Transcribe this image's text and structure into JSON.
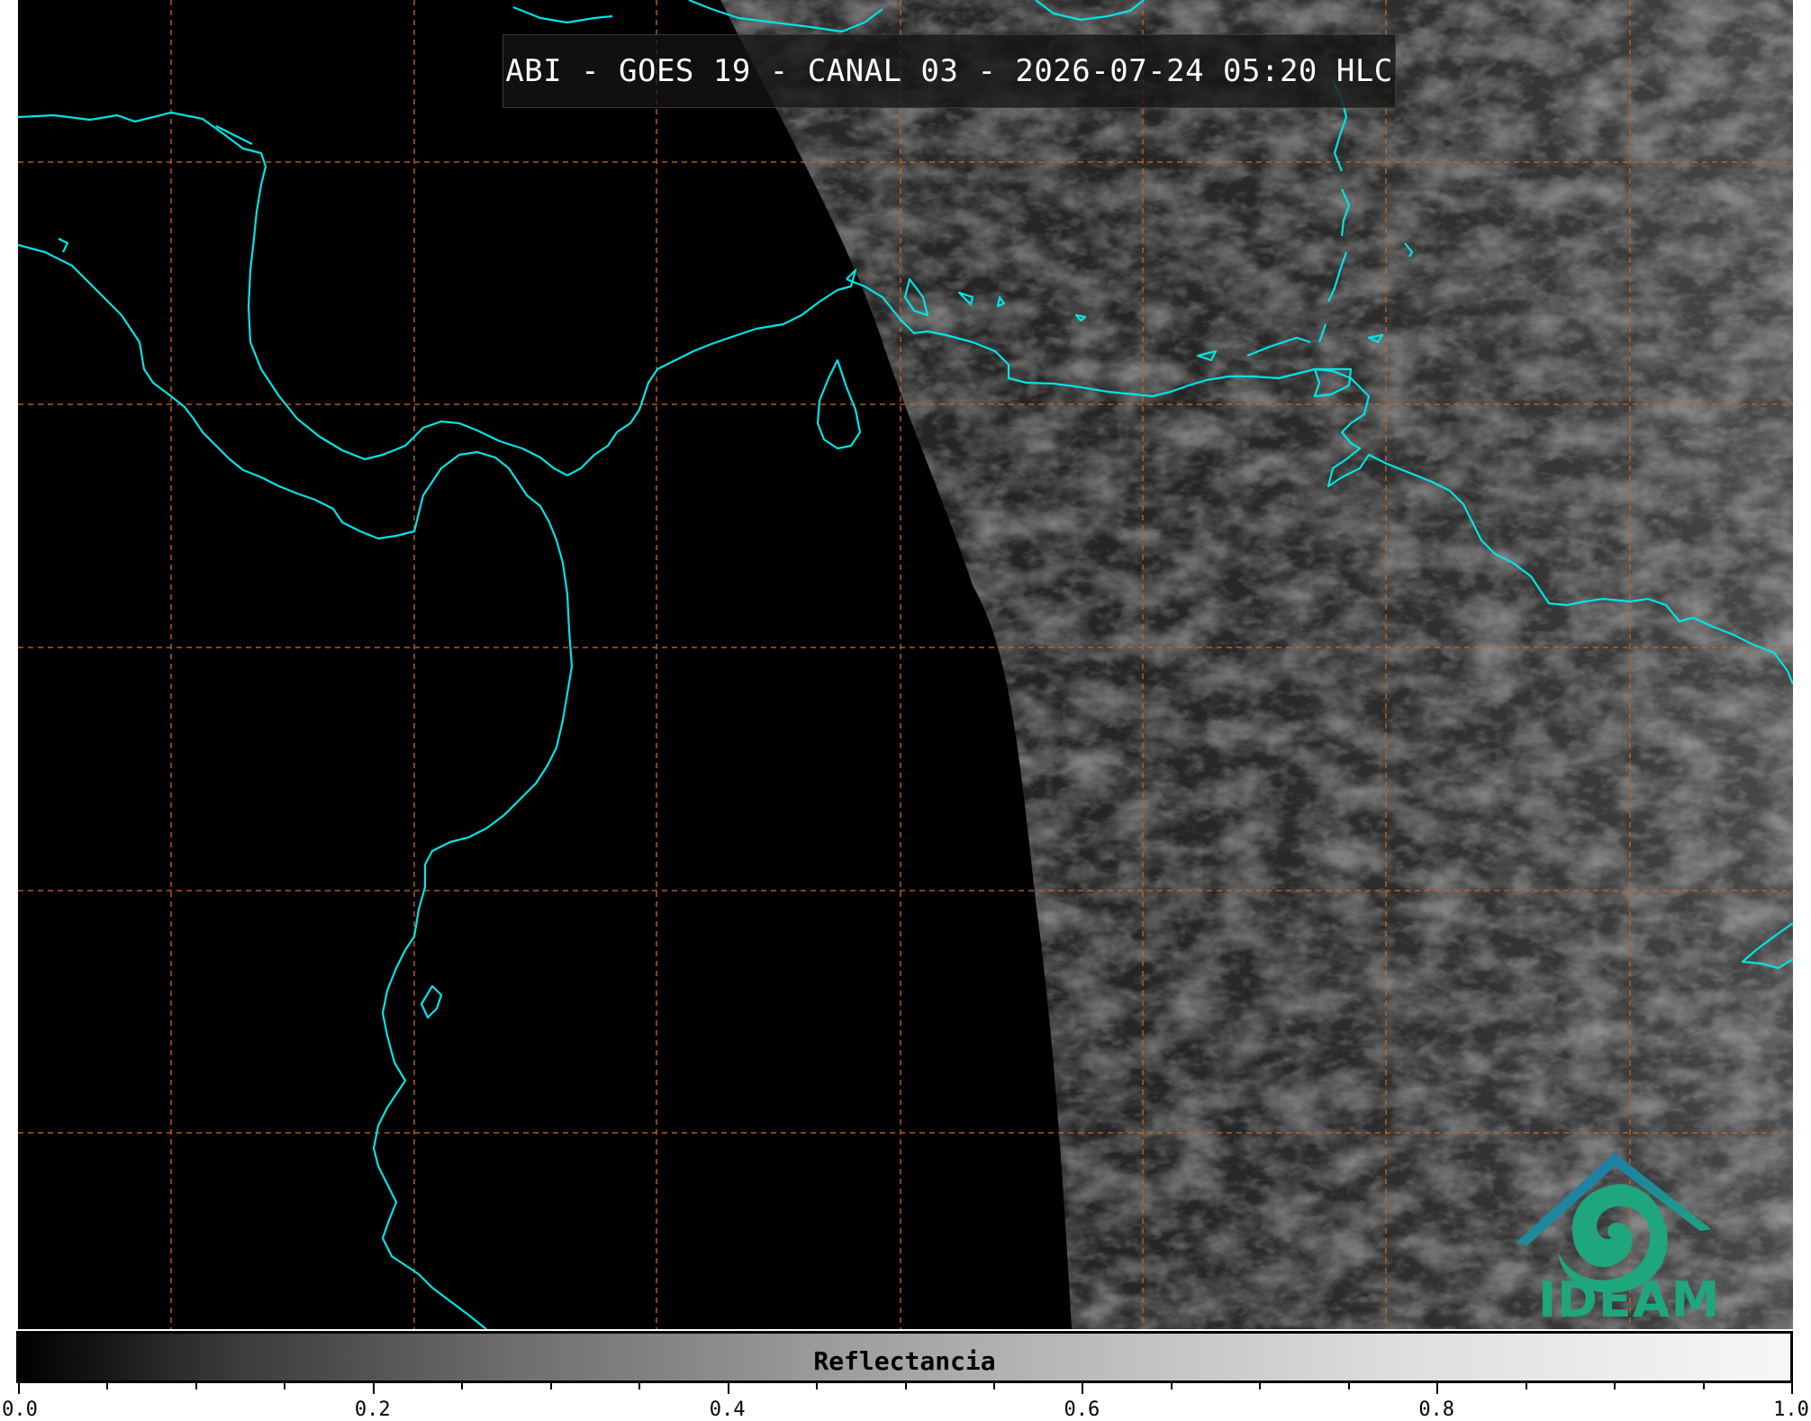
{
  "title": "ABI - GOES 19 - CANAL 03 - 2026-07-24 05:20 HLC",
  "logo": {
    "text": "IDEAM",
    "icon": "ideam-logo-icon"
  },
  "colorbar": {
    "label": "Reflectancia",
    "min": 0.0,
    "max": 1.0,
    "ticks": [
      "0.0",
      "0.2",
      "0.4",
      "0.6",
      "0.8",
      "1.0"
    ]
  },
  "colors": {
    "coastline": "#00e5e5",
    "gridlines": "#c8641e",
    "logo_green": "#1fa67c",
    "logo_blue": "#1f6fb8"
  }
}
